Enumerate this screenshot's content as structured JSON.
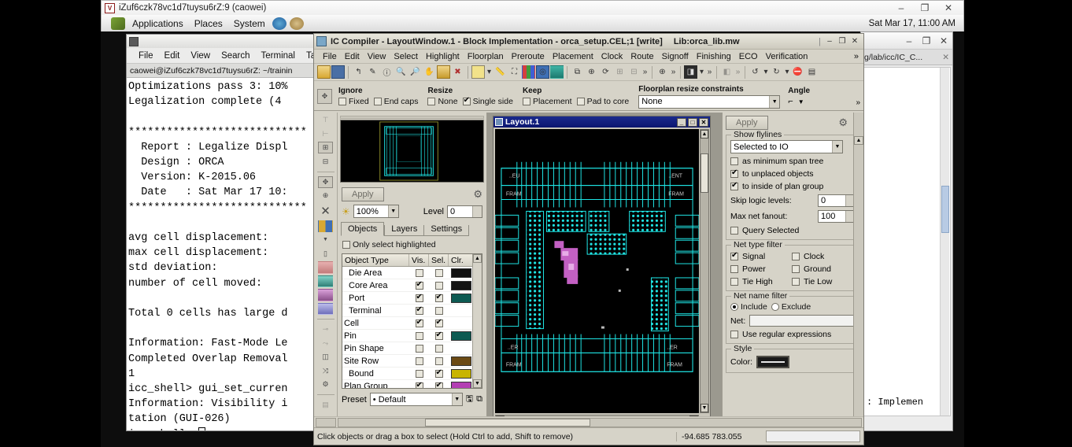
{
  "vnc_window": {
    "title": "iZuf6czk78vc1d7tuysu6rZ:9 (caowei)",
    "icon_label": "V",
    "minimize": "–",
    "maximize": "❐",
    "close": "✕"
  },
  "gnome_panel": {
    "menus": [
      "Applications",
      "Places",
      "System"
    ],
    "icons": [
      "web-browser-icon",
      "help-icon"
    ],
    "clock": "Sat Mar 17, 11:00 AM"
  },
  "terminal": {
    "menus": [
      "File",
      "Edit",
      "View",
      "Search",
      "Terminal",
      "Tabs"
    ],
    "tab_title": "caowei@iZuf6czk78vc1d7tuysu6rZ: ~/trainin",
    "content": "Optimizations pass 3: 10%\nLegalization complete (4\n\n****************************\n  Report : Legalize Displ\n  Design : ORCA\n  Version: K-2015.06\n  Date   : Sat Mar 17 10:\n****************************\n\navg cell displacement:\nmax cell displacement:\nstd deviation:\nnumber of cell moved:\n\nTotal 0 cells has large d\n\nInformation: Fast-Mode Le\nCompleted Overlap Removal\n1\nicc_shell> gui_set_curren\nInformation: Visibility i\ntation (GUI-026)\nicc_shell> "
  },
  "icc": {
    "title": "IC Compiler - LayoutWindow.1 - Block Implementation - orca_setup.CEL;1 [write]",
    "library": "Lib:orca_lib.mw",
    "window_controls": {
      "minimize": "–",
      "maximize": "❐",
      "close": "✕"
    },
    "menus": [
      "File",
      "Edit",
      "View",
      "Select",
      "Highlight",
      "Floorplan",
      "Preroute",
      "Placement",
      "Clock",
      "Route",
      "Signoff",
      "Finishing",
      "ECO",
      "Verification"
    ],
    "menu_overflow": "»",
    "toolbar_icons": [
      "open-icon",
      "save-icon",
      "undo-arrow-icon",
      "pencil-icon",
      "info-icon",
      "zoom-in-icon",
      "zoom-out-icon",
      "zoom-fit-icon",
      "folder-icon",
      "delete-icon",
      "color-box-icon",
      "dropdown-icon",
      "ruler-icon",
      "hierarchy-icon",
      "colormap-icon",
      "target-icon",
      "layers-icon",
      "copy-icon",
      "query-icon",
      "refresh-icon",
      "grid-icon",
      "snap-icon",
      "more-icon",
      "zoom-area-icon",
      "more2-icon",
      "window-icon",
      "more3-icon",
      "prev-icon",
      "more4-icon",
      "undo-icon",
      "redo-icon",
      "stop-icon",
      "report-icon"
    ],
    "resize_toolbar": {
      "drag_handle_icon": "move-handle-icon",
      "groups": [
        {
          "title": "Ignore",
          "items": [
            {
              "label": "Fixed",
              "checked": false
            },
            {
              "label": "End caps",
              "checked": false
            }
          ]
        },
        {
          "title": "Resize",
          "items": [
            {
              "label": "None",
              "checked": false
            },
            {
              "label": "Single side",
              "checked": true
            }
          ]
        },
        {
          "title": "Keep",
          "items": [
            {
              "label": "Placement",
              "checked": false
            },
            {
              "label": "Pad to core",
              "checked": false
            }
          ]
        }
      ],
      "constraints_label": "Floorplan resize constraints",
      "constraints_value": "None",
      "angle_label": "Angle",
      "angle_icon": "angle-icon",
      "overflow": "»"
    },
    "left_panel": {
      "apply_label": "Apply",
      "gear_icon": "gear-icon",
      "brightness_icon": "brightness-icon",
      "zoom_value": "100%",
      "level_label": "Level",
      "level_value": "0",
      "tabs": [
        "Objects",
        "Layers",
        "Settings"
      ],
      "active_tab": "Objects",
      "only_select_highlighted": {
        "label": "Only select highlighted",
        "checked": false
      },
      "table_headers": [
        "Object Type",
        "Vis.",
        "Sel.",
        "Clr."
      ],
      "rows": [
        {
          "name": "Die Area",
          "indent": "–",
          "vis": false,
          "sel": false,
          "color": "#101010"
        },
        {
          "name": "Core Area",
          "indent": "–",
          "vis": true,
          "sel": false,
          "color": "#141414"
        },
        {
          "name": "Port",
          "indent": "–",
          "vis": true,
          "sel": true,
          "color": "#0d5a52"
        },
        {
          "name": "Terminal",
          "indent": "–",
          "vis": true,
          "sel": false,
          "color": ""
        },
        {
          "name": "Cell",
          "indent": "+",
          "vis": true,
          "sel": true,
          "color": ""
        },
        {
          "name": "Pin",
          "indent": "+",
          "vis": false,
          "sel": true,
          "color": "#0d5a52"
        },
        {
          "name": "Pin Shape",
          "indent": "+",
          "vis": false,
          "sel": false,
          "color": ""
        },
        {
          "name": "Site Row",
          "indent": "+",
          "vis": false,
          "sel": false,
          "color": "#6b4a14"
        },
        {
          "name": "Bound",
          "indent": "–",
          "vis": false,
          "sel": true,
          "color": "#c8b400"
        },
        {
          "name": "Plan Group",
          "indent": "+",
          "vis": true,
          "sel": true,
          "color": "#b43fb4"
        }
      ],
      "preset_label": "Preset",
      "preset_value": "• Default"
    },
    "layout_window": {
      "title": "Layout.1",
      "icon": "layout-icon",
      "minimize": "_",
      "maximize": "□",
      "close": "✕",
      "labels": {
        "top_left": "..EU",
        "top_right": "..ENT",
        "left_mid": "FRAM",
        "right_mid": "FRAM",
        "bottom_left": "..ER",
        "bottom_right": "..ER",
        "bottom_left2": "FRAM",
        "bottom_right2": "FRAM"
      }
    },
    "right_panel": {
      "apply_label": "Apply",
      "gear_icon": "gear-icon",
      "show_flylines": {
        "legend": "Show flylines",
        "selection": "Selected to IO",
        "options": [
          {
            "label": "as minimum span tree",
            "checked": false
          },
          {
            "label": "to unplaced objects",
            "checked": true
          },
          {
            "label": "to inside of plan group",
            "checked": true
          }
        ],
        "skip_logic_levels_label": "Skip logic levels:",
        "skip_logic_levels_value": "0",
        "max_net_fanout_label": "Max net fanout:",
        "max_net_fanout_value": "100",
        "query_selected": {
          "label": "Query Selected",
          "checked": false
        }
      },
      "net_type_filter": {
        "legend": "Net type filter",
        "items": [
          {
            "label": "Signal",
            "checked": true
          },
          {
            "label": "Clock",
            "checked": false
          },
          {
            "label": "Power",
            "checked": false
          },
          {
            "label": "Ground",
            "checked": false
          },
          {
            "label": "Tie High",
            "checked": false
          },
          {
            "label": "Tie Low",
            "checked": false
          }
        ]
      },
      "net_name_filter": {
        "legend": "Net name filter",
        "include_label": "Include",
        "exclude_label": "Exclude",
        "mode": "Include",
        "net_label": "Net:",
        "net_value": "",
        "regex": {
          "label": "Use regular expressions",
          "checked": false
        }
      },
      "style": {
        "legend": "Style",
        "color_label": "Color:",
        "color_value": "#1a1a1a"
      }
    },
    "status_bar": {
      "message": "Click objects or drag a box to select (Hold Ctrl to add, Shift to remove)",
      "coordinates": "-94.685 783.055",
      "field_value": ""
    }
  },
  "background_window": {
    "tab_title": "g/lab/icc/IC_C...",
    "tab_close": "✕",
    "minimize": "–",
    "maximize": "❐",
    "close": "✕",
    "content_fragment": ": Implemen"
  },
  "colors": {
    "chrome": "#d6d3c8",
    "layout_cyan": "#1fe5e5",
    "layout_magenta": "#d469d4",
    "title_blue": "#0b1570",
    "accent_green": "#0d5a52"
  }
}
